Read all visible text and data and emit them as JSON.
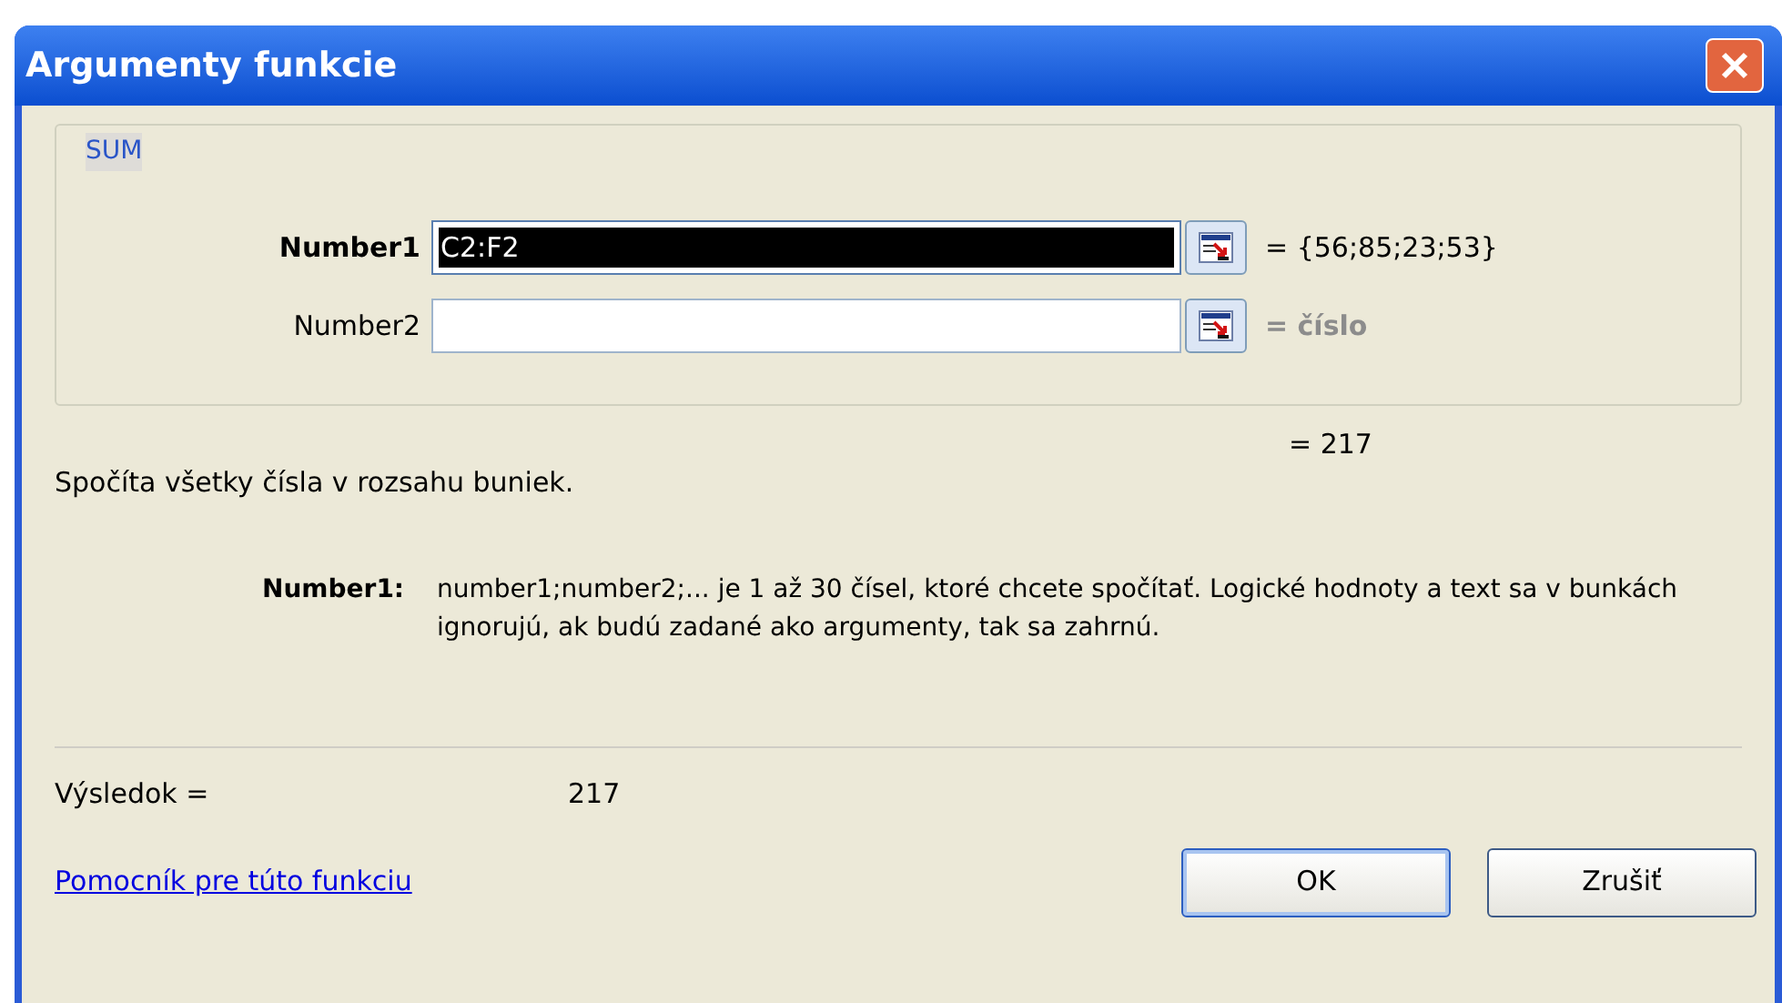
{
  "window": {
    "title": "Argumenty funkcie"
  },
  "function": {
    "name": "SUM",
    "arguments": [
      {
        "label": "Number1",
        "value": "C2:F2",
        "selected": true,
        "result": "= {56;85;23;53}"
      },
      {
        "label": "Number2",
        "selected": false,
        "result": "= číslo"
      }
    ],
    "total": "= 217",
    "description": "Spočíta všetky čísla v rozsahu buniek.",
    "help": {
      "label": "Number1:",
      "text": "number1;number2;... je 1 až 30 čísel, ktoré chcete spočítať. Logické hodnoty a text sa v bunkách ignorujú, ak budú zadané ako argumenty, tak sa zahrnú."
    }
  },
  "result": {
    "label": "Výsledok =",
    "value": "217"
  },
  "link": "Pomocník pre túto funkciu",
  "buttons": [
    "OK",
    "Zrušiť"
  ]
}
